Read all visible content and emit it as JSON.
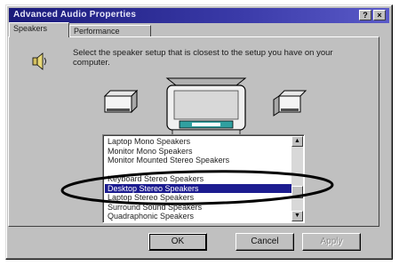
{
  "window": {
    "title": "Advanced Audio Properties",
    "help_label": "?",
    "close_label": "×"
  },
  "tabs": [
    {
      "label": "Speakers",
      "active": true
    },
    {
      "label": "Performance",
      "active": false
    }
  ],
  "speakers": {
    "description": "Select the speaker setup that is closest to the setup you have on your computer.",
    "icons": {
      "speaker": "speaker-icon",
      "left_speaker": "left-speaker-icon",
      "right_speaker": "right-speaker-icon",
      "monitor": "monitor-icon"
    },
    "list": {
      "items": [
        "Laptop Mono Speakers",
        "Monitor Mono Speakers",
        "Monitor Mounted Stereo Speakers",
        "",
        "Keyboard Stereo Speakers",
        "Desktop Stereo Speakers",
        "Laptop Stereo Speakers",
        "Surround Sound Speakers",
        "Quadraphonic Speakers"
      ],
      "selected_index": 5
    },
    "annotation_color": "#000000",
    "selection_color": "#1c1c90"
  },
  "buttons": {
    "ok": "OK",
    "cancel": "Cancel",
    "apply": "Apply"
  }
}
